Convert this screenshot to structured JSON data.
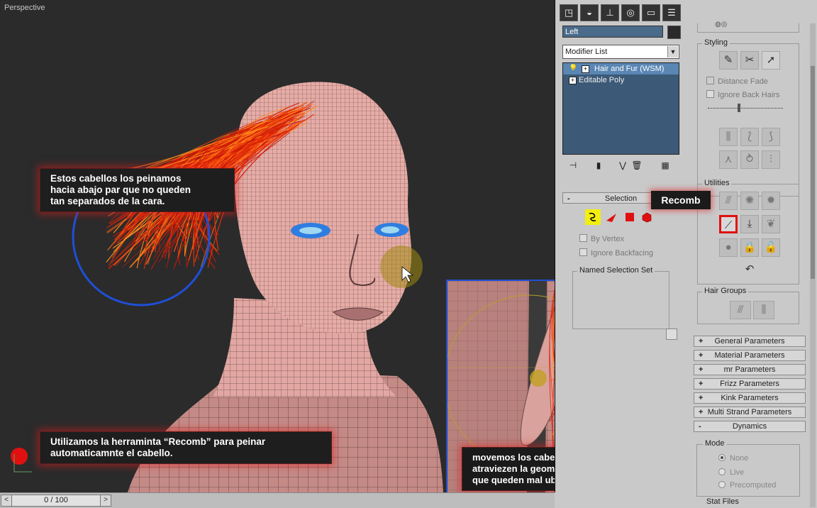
{
  "viewport": {
    "label": "Perspective",
    "callout_top": "Estos cabellos los peinamos\nhacia abajo par que no queden\ntan separados de la cara.",
    "callout_bottom": "Utilizamos la herraminta “Recomb” para peinar\nautomaticamnte  el cabello.",
    "callout_inset": "movemos los cabellos que\natraviezen la geometría o\nque queden mal ubicados."
  },
  "timebar": {
    "frame": "0 / 100",
    "prev": "<",
    "next": ">"
  },
  "command_panel": {
    "tabs": [
      "create-tab",
      "modify-tab",
      "hierarchy-tab",
      "motion-tab",
      "display-tab",
      "utilities-tab"
    ],
    "object_name": "Left",
    "modifier_list": "Modifier List",
    "stack": [
      {
        "label": "Hair and Fur (WSM)",
        "selected": true
      },
      {
        "label": "Editable Poly",
        "selected": false
      }
    ],
    "selection": {
      "title": "Selection",
      "by_vertex": "By Vertex",
      "ignore_backfacing": "Ignore Backfacing",
      "named_selection_set": "Named Selection Set"
    },
    "styling": {
      "title": "Styling",
      "distance_fade": "Distance Fade",
      "ignore_back_hairs": "Ignore Back Hairs"
    },
    "utilities": {
      "title": "Utilities",
      "recomb_label": "Recomb"
    },
    "hair_groups": {
      "title": "Hair Groups"
    },
    "params": [
      {
        "label": "General Parameters",
        "sign": "+"
      },
      {
        "label": "Material Parameters",
        "sign": "+"
      },
      {
        "label": "mr Parameters",
        "sign": "+"
      },
      {
        "label": "Frizz Parameters",
        "sign": "+"
      },
      {
        "label": "Kink Parameters",
        "sign": "+"
      },
      {
        "label": "Multi Strand Parameters",
        "sign": "+"
      },
      {
        "label": "Dynamics",
        "sign": "-"
      }
    ],
    "dynamics": {
      "mode": "Mode",
      "none": "None",
      "live": "Live",
      "precomputed": "Precomputed",
      "stat_files": "Stat Files"
    }
  },
  "colors": {
    "hair": "#e8300a",
    "mesh": "#e8a8a0",
    "selection_blue": "#1f4fd6",
    "highlight_red": "#e01010"
  }
}
